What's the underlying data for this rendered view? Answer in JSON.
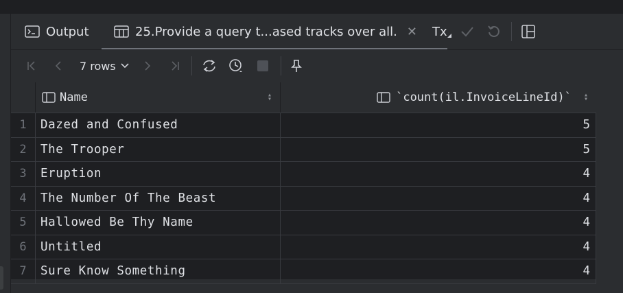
{
  "tabs": [
    {
      "label": "Output"
    },
    {
      "label": "25.Provide a query t...ased tracks over all."
    }
  ],
  "toolbar": {
    "tx_label": "Tx",
    "rows_label": "7 rows"
  },
  "columns": [
    {
      "label": "Name"
    },
    {
      "label": "`count(il.InvoiceLineId)`"
    }
  ],
  "rows": [
    {
      "num": "1",
      "name": "Dazed and Confused",
      "count": "5"
    },
    {
      "num": "2",
      "name": "The Trooper",
      "count": "5"
    },
    {
      "num": "3",
      "name": "Eruption",
      "count": "4"
    },
    {
      "num": "4",
      "name": "The Number Of The Beast",
      "count": "4"
    },
    {
      "num": "5",
      "name": "Hallowed Be Thy Name",
      "count": "4"
    },
    {
      "num": "6",
      "name": "Untitled",
      "count": "4"
    },
    {
      "num": "7",
      "name": "Sure Know Something",
      "count": "4"
    }
  ],
  "colors": {
    "background": "#2b2d30",
    "grid_background": "#1e1f22",
    "text": "#dfe1e5",
    "muted": "#6f737a"
  }
}
